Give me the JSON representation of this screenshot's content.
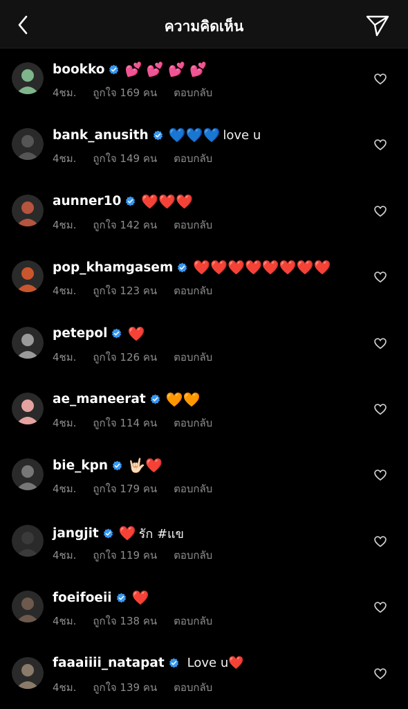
{
  "header": {
    "title": "ความคิดเห็น",
    "back_icon": "chevron-left-icon",
    "send_icon": "paper-plane-icon"
  },
  "colors": {
    "verified": "#3897f0",
    "meta": "#8e8e8e",
    "background": "#000000",
    "header_bg": "#121212"
  },
  "comments": [
    {
      "username": "bookko",
      "emojis": "💕 💕 💕 💕",
      "text": "",
      "time": "4ชม.",
      "likes": "ถูกใจ 169 คน",
      "reply": "ตอบกลับ",
      "avatar_color": "#7fb58a"
    },
    {
      "username": "bank_anusith",
      "emojis": "💙💙💙",
      "text": "love u",
      "time": "4ชม.",
      "likes": "ถูกใจ 149 คน",
      "reply": "ตอบกลับ",
      "avatar_color": "#555555"
    },
    {
      "username": "aunner10",
      "emojis": "❤️❤️❤️",
      "text": "",
      "time": "4ชม.",
      "likes": "ถูกใจ 142 คน",
      "reply": "ตอบกลับ",
      "avatar_color": "#b5543f"
    },
    {
      "username": "pop_khamgasem",
      "emojis": "❤️❤️❤️❤️❤️❤️❤️❤️",
      "text": "",
      "time": "4ชม.",
      "likes": "ถูกใจ 123 คน",
      "reply": "ตอบกลับ",
      "avatar_color": "#c9562d"
    },
    {
      "username": "petepol",
      "emojis": "❤️",
      "text": "",
      "time": "4ชม.",
      "likes": "ถูกใจ 126 คน",
      "reply": "ตอบกลับ",
      "avatar_color": "#9a9a9a"
    },
    {
      "username": "ae_maneerat",
      "emojis": "🧡🧡",
      "text": "",
      "time": "4ชม.",
      "likes": "ถูกใจ 114 คน",
      "reply": "ตอบกลับ",
      "avatar_color": "#e4a3a0"
    },
    {
      "username": "bie_kpn",
      "emojis": "🤟🏻❤️",
      "text": "",
      "time": "4ชม.",
      "likes": "ถูกใจ 179 คน",
      "reply": "ตอบกลับ",
      "avatar_color": "#777777"
    },
    {
      "username": "jangjit",
      "emojis": "❤️",
      "text": "รัก #แข",
      "time": "4ชม.",
      "likes": "ถูกใจ 119 คน",
      "reply": "ตอบกลับ",
      "avatar_color": "#3a3a3a"
    },
    {
      "username": "foeifoeii",
      "emojis": "❤️",
      "text": "",
      "time": "4ชม.",
      "likes": "ถูกใจ 138 คน",
      "reply": "ตอบกลับ",
      "avatar_color": "#6d5a4c"
    },
    {
      "username": "faaaiiii_natapat",
      "emojis": "",
      "text": "Love u❤️",
      "time": "4ชม.",
      "likes": "ถูกใจ 139 คน",
      "reply": "ตอบกลับ",
      "avatar_color": "#8a7a6a"
    }
  ]
}
